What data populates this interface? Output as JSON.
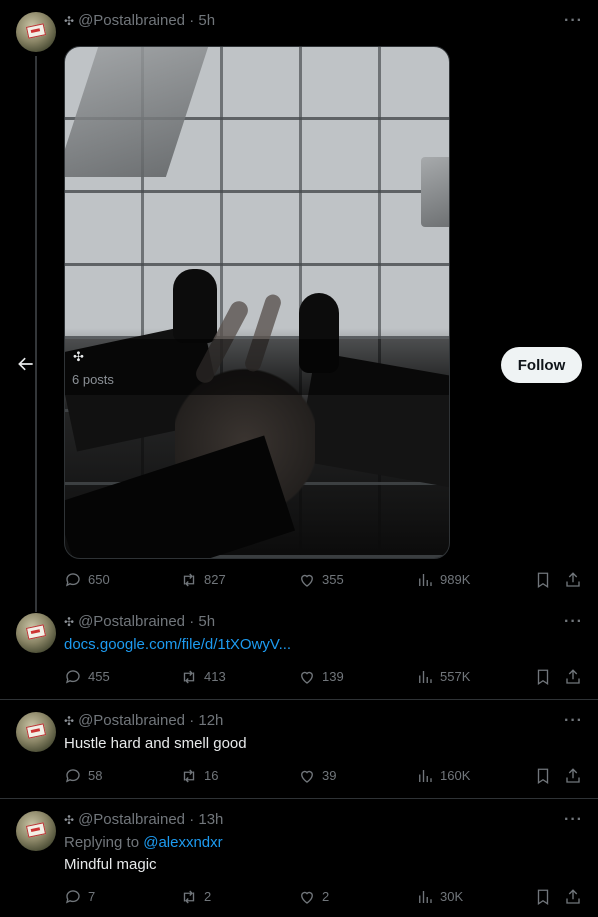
{
  "posts": [
    {
      "author": "@Postalbrained",
      "time": "5h",
      "media": {
        "overlay_symbol": "✣",
        "overlay_count": "6 posts"
      },
      "stats": {
        "replies": "650",
        "reposts": "827",
        "likes": "355",
        "views": "989K"
      }
    },
    {
      "author": "@Postalbrained",
      "time": "5h",
      "link": "docs.google.com/file/d/1tXOwyV...",
      "stats": {
        "replies": "455",
        "reposts": "413",
        "likes": "139",
        "views": "557K"
      }
    },
    {
      "author": "@Postalbrained",
      "time": "12h",
      "text": "Hustle hard and smell good",
      "stats": {
        "replies": "58",
        "reposts": "16",
        "likes": "39",
        "views": "160K"
      }
    },
    {
      "author": "@Postalbrained",
      "time": "13h",
      "replying_prefix": "Replying to",
      "replying_to": "@alexxndxr",
      "text": "Mindful magic",
      "stats": {
        "replies": "7",
        "reposts": "2",
        "likes": "2",
        "views": "30K"
      }
    }
  ],
  "name_symbol": "✣",
  "separator": "·",
  "more_label": "···",
  "follow_label": "Follow",
  "icons": {
    "reply": "speech-bubble-icon",
    "repost": "repost-arrows-icon",
    "like": "heart-icon",
    "views": "bar-chart-icon",
    "bookmark": "bookmark-icon",
    "share": "share-upload-icon",
    "back": "back-arrow-icon"
  },
  "colors": {
    "background": "#000000",
    "text": "#e7e9ea",
    "muted": "#71767b",
    "link": "#1d9bf0",
    "follow_bg": "#eff3f4"
  }
}
